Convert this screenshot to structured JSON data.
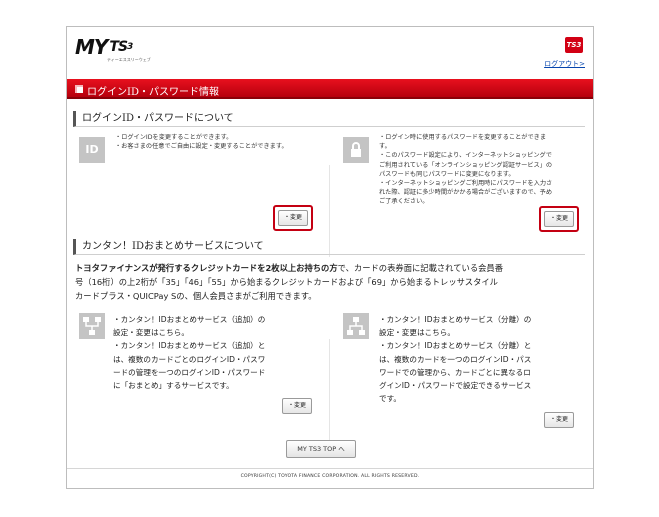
{
  "header": {
    "logo_main": "MY",
    "logo_ts": "TS",
    "logo_sup": "3",
    "logo_sub": "ティーエススリーウェブ",
    "badge": "TS3",
    "logout": "ログアウト>"
  },
  "page_title": "ログインID・パスワード情報",
  "section1": {
    "heading": "ログインID・パスワードについて",
    "id_icon": "ID",
    "left_lines": [
      "・ログインIDを変更することができます。",
      "・お客さまの任意でご自由に設定・変更することができます。"
    ],
    "right_lines": [
      "・ログイン時に使用するパスワードを変更することができま",
      "す。",
      "・このパスワード設定により、インターネットショッピングで",
      "ご利用されている「オンラインショッピング認証サービス」の",
      "パスワードも同じパスワードに変更になります。",
      "・インターネットショッピングご利用時にパスワードを入力さ",
      "れた際、認証に多少時間がかかる場合がございますので、予め",
      "ご了承ください。"
    ],
    "change_label": "・変更"
  },
  "section2": {
    "heading": "カンタン！IDおまとめサービスについて",
    "lead_bold": "トヨタファイナンスが発行するクレジットカードを2枚以上お持ちの方",
    "lead_rest1": "で、カードの表券面に記載されている会員番",
    "lead_line2": "号（16桁）の上2桁が「35」「46」「55」から始まるクレジットカードおよび「69」から始まるトレッサスタイル",
    "lead_line3": "カードプラス・QUICPay Sの、個人会員さまがご利用できます。",
    "left_lines": [
      "・カンタン！IDおまとめサービス（追加）の",
      "設定・変更はこちら。",
      "・カンタン！IDおまとめサービス（追加）と",
      "は、複数のカードごとのログインID・パスワ",
      "ードの管理を一つのログインID・パスワード",
      "に「おまとめ」するサービスです。"
    ],
    "right_lines": [
      "・カンタン！IDおまとめサービス（分離）の",
      "設定・変更はこちら。",
      "・カンタン！IDおまとめサービス（分離）と",
      "は、複数のカードを一つのログインID・パス",
      "ワードでの管理から、カードごとに異なるロ",
      "グインID・パスワードで設定できるサービス",
      "です。"
    ],
    "change_label": "・変更"
  },
  "footer": {
    "top_button": "MY TS3 TOP へ",
    "copyright": "COPYRIGHT(C) TOYOTA FINANCE CORPORATION. ALL RIGHTS RESERVED."
  },
  "colors": {
    "brand_red": "#d20014",
    "highlight_red": "#c40012",
    "icon_gray": "#c4c4c4"
  },
  "icons": [
    "id-card-icon",
    "lock-icon",
    "merge-accounts-icon",
    "split-accounts-icon"
  ]
}
